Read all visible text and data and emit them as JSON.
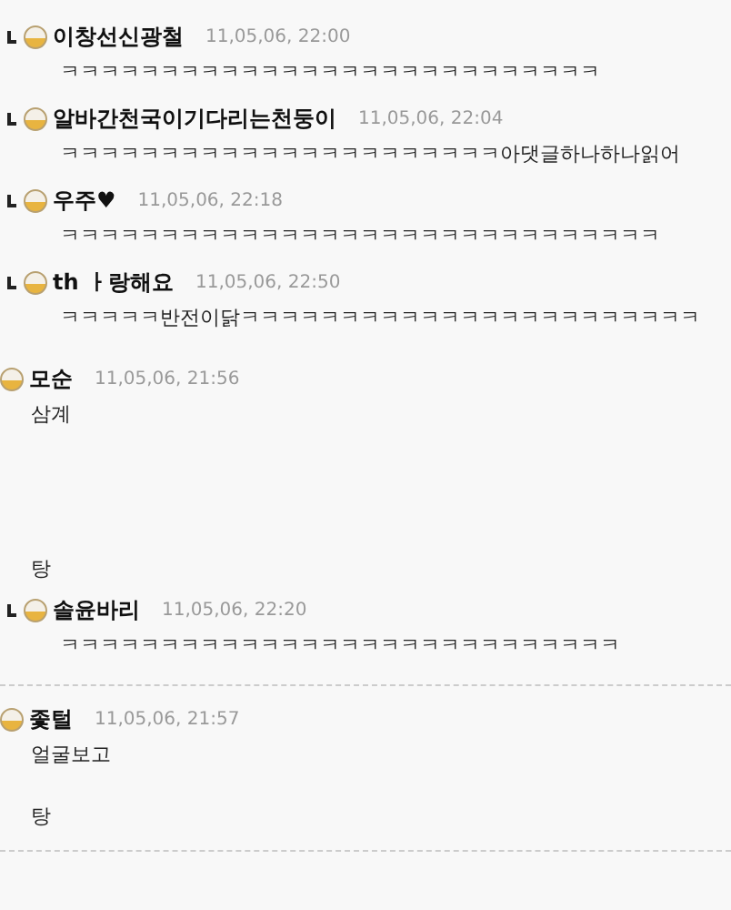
{
  "replies": [
    {
      "author": "이창선신광철",
      "date": "11,05,06, 22:00",
      "body": "ㅋㅋㅋㅋㅋㅋㅋㅋㅋㅋㅋㅋㅋㅋㅋㅋㅋㅋㅋㅋㅋㅋㅋㅋㅋㅋㅋ"
    },
    {
      "author": "알바간천국이기다리는천둥이",
      "date": "11,05,06, 22:04",
      "body": "ㅋㅋㅋㅋㅋㅋㅋㅋㅋㅋㅋㅋㅋㅋㅋㅋㅋㅋㅋㅋㅋㅋ아댓글하나하나읽어"
    },
    {
      "author": "우주♥",
      "date": "11,05,06, 22:18",
      "body": "ㅋㅋㅋㅋㅋㅋㅋㅋㅋㅋㅋㅋㅋㅋㅋㅋㅋㅋㅋㅋㅋㅋㅋㅋㅋㅋㅋㅋㅋㅋ"
    },
    {
      "author": "th ㅏ랑해요",
      "date": "11,05,06, 22:50",
      "body": "ㅋㅋㅋㅋㅋ반전이닭ㅋㅋㅋㅋㅋㅋㅋㅋㅋㅋㅋㅋㅋㅋㅋㅋㅋㅋㅋㅋㅋㅋㅋ"
    }
  ],
  "comments": [
    {
      "author": "모순",
      "date": "11,05,06, 21:56",
      "body": "삼계\n\n\n\n\n탕",
      "replies": [
        {
          "author": "솔윤바리",
          "date": "11,05,06, 22:20",
          "body": "ㅋㅋㅋㅋㅋㅋㅋㅋㅋㅋㅋㅋㅋㅋㅋㅋㅋㅋㅋㅋㅋㅋㅋㅋㅋㅋㅋㅋ"
        }
      ]
    },
    {
      "author": "좇털",
      "date": "11,05,06, 21:57",
      "body": "얼굴보고\n\n탕"
    }
  ]
}
